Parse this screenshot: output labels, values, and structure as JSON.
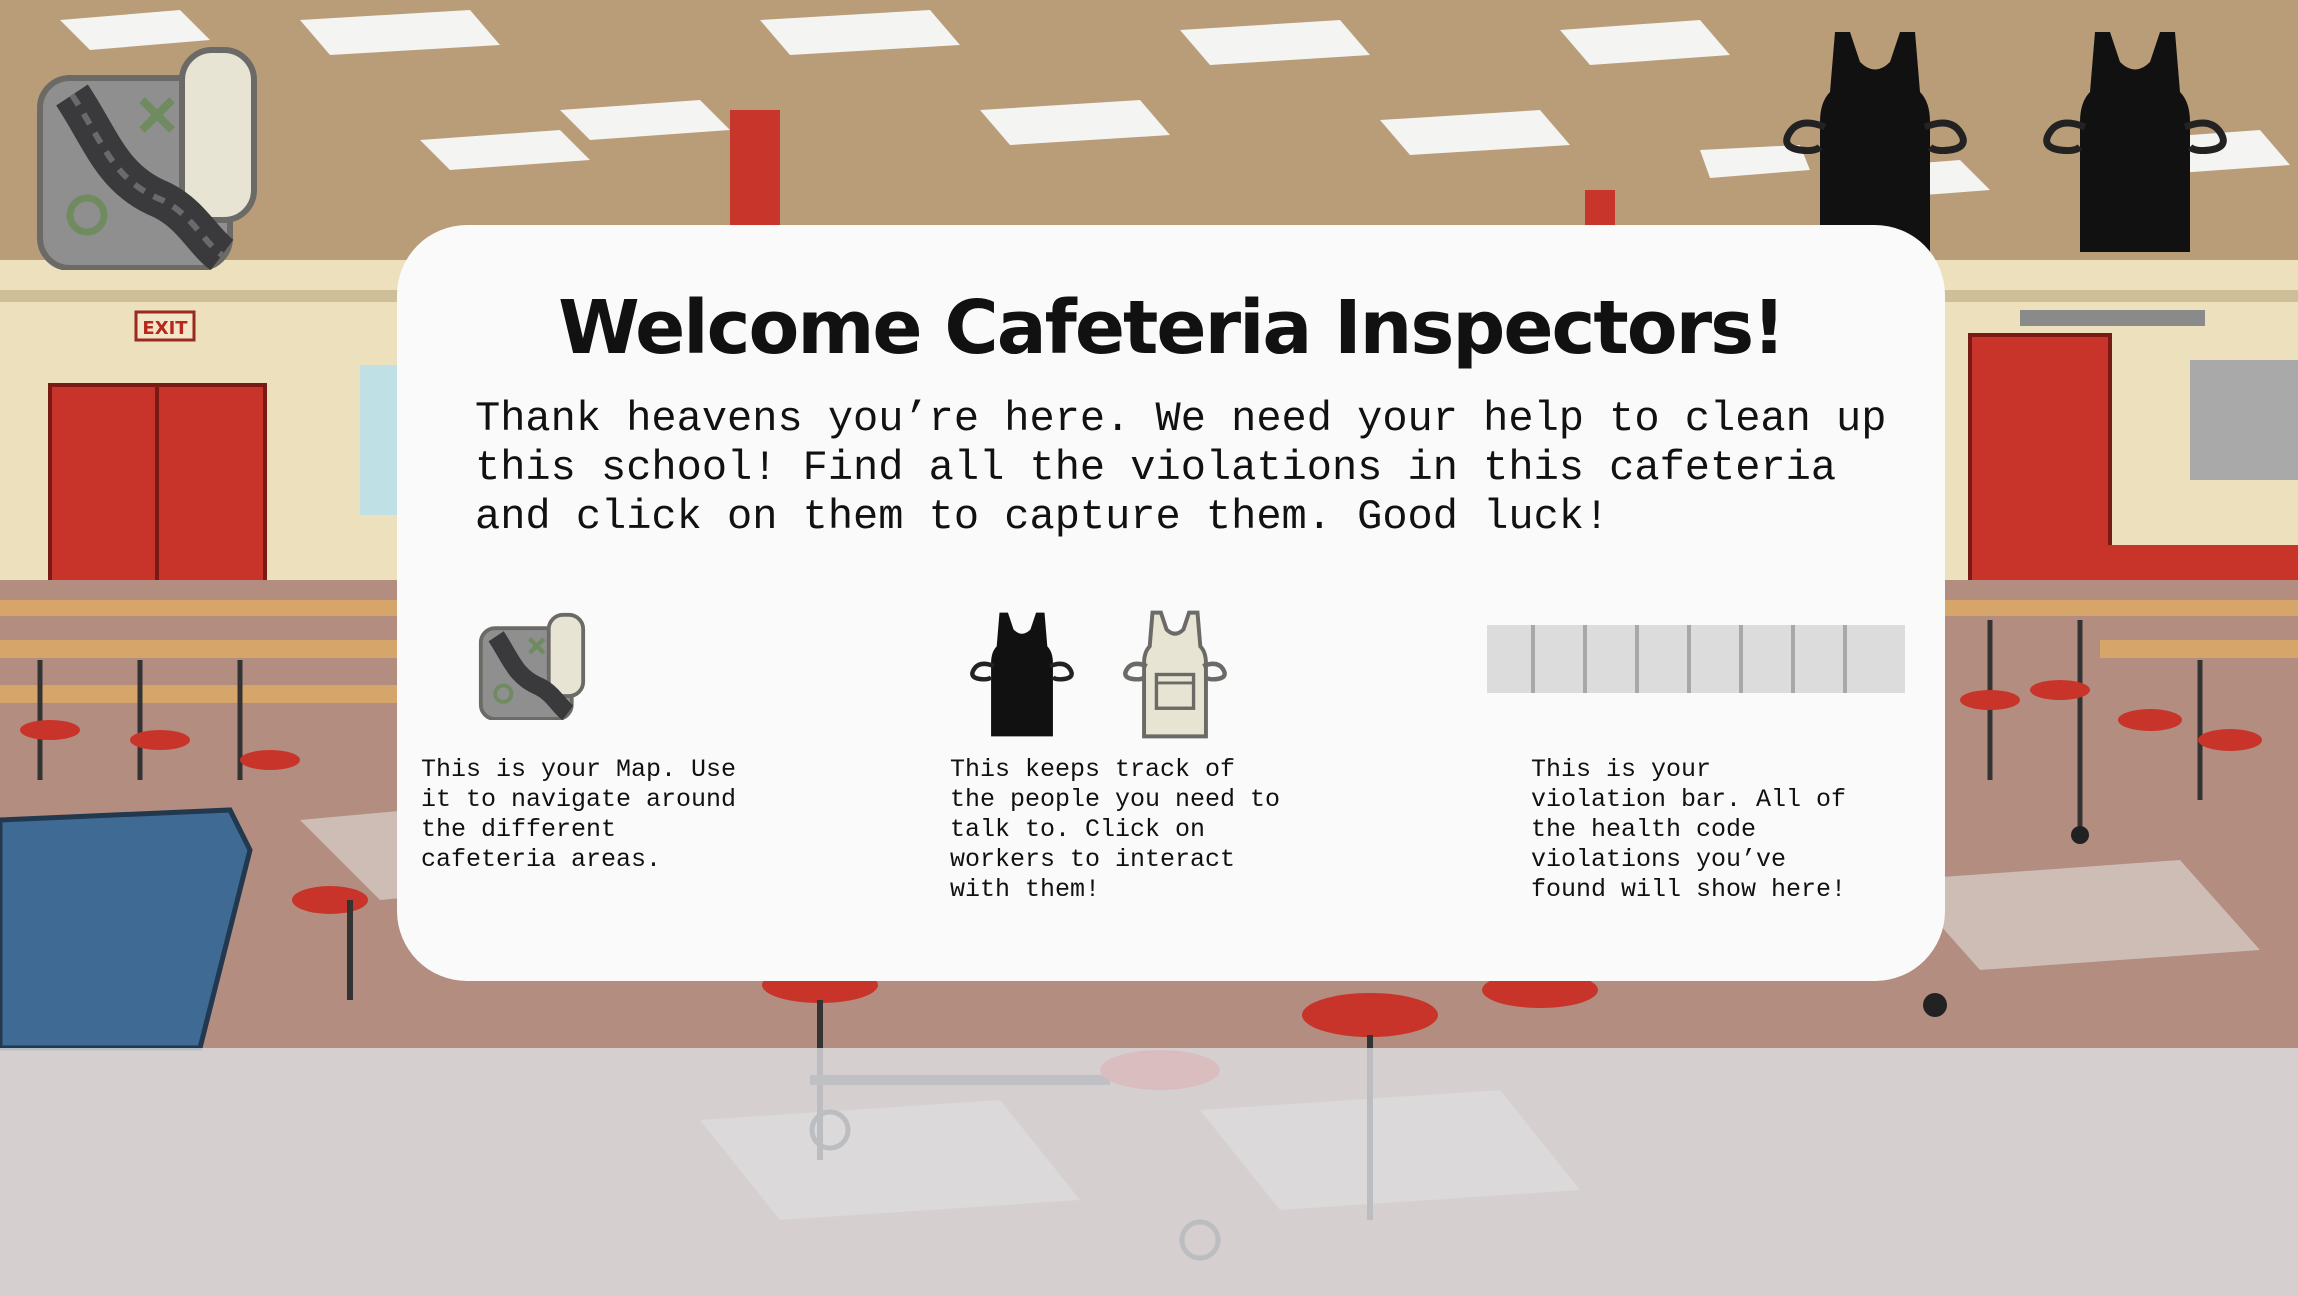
{
  "modal": {
    "title": "Welcome Cafeteria Inspectors!",
    "intro": "Thank heavens you’re here. We need your help to clean up this school! Find all the violations in this cafeteria and click on them to capture them. Good luck!",
    "help": [
      {
        "icon": "map-icon",
        "text": "This is your Map. Use it to navigate around the different cafeteria areas."
      },
      {
        "icon": "apron-tracker-icon",
        "text": "This keeps track of the people you need to talk to. Click on workers to interact with them!"
      },
      {
        "icon": "violation-bar-icon",
        "text": "This is your violation bar. All of the health code violations you’ve found will show here!"
      }
    ]
  },
  "hud": {
    "map_icon": "map-icon",
    "people_tracker": [
      {
        "icon": "apron-icon",
        "found": false
      },
      {
        "icon": "apron-icon",
        "found": false
      }
    ]
  },
  "scene": {
    "exit_sign": "EXIT"
  },
  "colors": {
    "modal_bg": "#fafafa",
    "apron_dark": "#111111",
    "apron_light": "#e8e4d4",
    "violation_bar": "#dcdcdc"
  }
}
